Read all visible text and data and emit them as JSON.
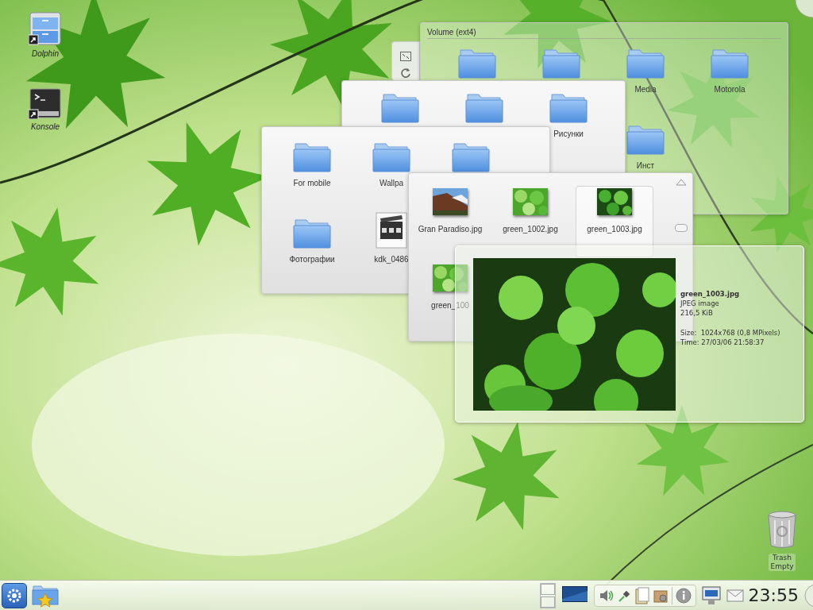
{
  "desktop_icons": [
    {
      "kind": "drawer",
      "label": "Dolphin"
    },
    {
      "kind": "terminal",
      "label": "Konsole"
    }
  ],
  "folder_views": [
    {
      "title": "Volume (ext4)",
      "items": [
        {
          "kind": "folder"
        },
        {
          "kind": "folder"
        },
        {
          "kind": "folder",
          "label": "Media"
        },
        {
          "kind": "folder",
          "label": "Motorola"
        },
        {
          "kind": "folder",
          "label": "Инст"
        }
      ]
    },
    {
      "items": [
        {
          "kind": "folder"
        },
        {
          "kind": "folder"
        },
        {
          "kind": "folder",
          "label": "Рисунки"
        }
      ]
    },
    {
      "items": [
        {
          "kind": "folder",
          "label": "For mobile"
        },
        {
          "kind": "folder",
          "label": "Wallpa"
        },
        {
          "kind": "folder"
        },
        {
          "kind": "folder",
          "label": "Фотографии"
        },
        {
          "kind": "video",
          "label": "kdk_0486"
        }
      ]
    },
    {
      "items": [
        {
          "label": "Gran Paradiso.jpg",
          "selected": false
        },
        {
          "label": "green_1002.jpg",
          "selected": false
        },
        {
          "label": "green_1003.jpg",
          "selected": true
        },
        {
          "label": "green_100",
          "selected": false
        }
      ]
    }
  ],
  "tooltip": {
    "name": "green_1003.jpg",
    "type": "JPEG image",
    "file_size": "216,5 KiB",
    "details": [
      "Size:  1024x768 (0,8 MPixels)",
      "Time: 27/03/06 21:58:37"
    ]
  },
  "trash": {
    "label": "Trash",
    "status": "Empty"
  },
  "taskbar": {
    "clock": "23:55"
  }
}
